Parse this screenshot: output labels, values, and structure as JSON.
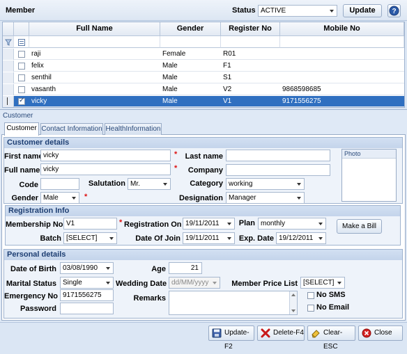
{
  "header": {
    "title": "Member",
    "status_label": "Status",
    "status_value": "ACTIVE",
    "update_label": "Update"
  },
  "grid": {
    "columns": [
      "Full Name",
      "Gender",
      "Register No",
      "Mobile No"
    ],
    "rows": [
      {
        "name": "raji",
        "gender": "Female",
        "reg": "R01",
        "mobile": "",
        "checked": false,
        "selected": false
      },
      {
        "name": "felix",
        "gender": "Male",
        "reg": "F1",
        "mobile": "",
        "checked": false,
        "selected": false
      },
      {
        "name": "senthil",
        "gender": "Male",
        "reg": "S1",
        "mobile": "",
        "checked": false,
        "selected": false
      },
      {
        "name": "vasanth",
        "gender": "Male",
        "reg": "V2",
        "mobile": "9868598685",
        "checked": false,
        "selected": false
      },
      {
        "name": "vicky",
        "gender": "Male",
        "reg": "V1",
        "mobile": "9171556275",
        "checked": true,
        "selected": true
      }
    ]
  },
  "panel": {
    "title": "Customer",
    "tabs": [
      "Customer",
      "Contact Information",
      "HealthInformation"
    ]
  },
  "customer_details": {
    "title": "Customer details",
    "first_name_label": "First name",
    "first_name": "vicky",
    "last_name_label": "Last name",
    "last_name": "",
    "full_name_label": "Full name",
    "full_name": "vicky",
    "company_label": "Company",
    "company": "",
    "code_label": "Code",
    "code": "",
    "salutation_label": "Salutation",
    "salutation": "Mr.",
    "category_label": "Category",
    "category": "working",
    "gender_label": "Gender",
    "gender": "Male",
    "designation_label": "Designation",
    "designation": "Manager",
    "photo_label": "Photo"
  },
  "registration": {
    "title": "Registration Info",
    "membership_label": "Membership No",
    "membership": "V1",
    "reg_on_label": "Registration On",
    "reg_on": "19/11/2011",
    "plan_label": "Plan",
    "plan": "monthly",
    "make_bill": "Make a Bill",
    "batch_label": "Batch",
    "batch": "[SELECT]",
    "doj_label": "Date Of Join",
    "doj": "19/11/2011",
    "exp_label": "Exp. Date",
    "exp": "19/12/2011"
  },
  "personal": {
    "title": "Personal details",
    "dob_label": "Date of Birth",
    "dob": "03/08/1990",
    "age_label": "Age",
    "age": "21",
    "marital_label": "Marital Status",
    "marital": "Single",
    "wedding_label": "Wedding Date",
    "wedding": "dd/MM/yyyy",
    "price_list_label": "Member Price List",
    "price_list": "[SELECT]",
    "emergency_label": "Emergency No",
    "emergency": "9171556275",
    "remarks_label": "Remarks",
    "remarks": "",
    "password_label": "Password",
    "password": "",
    "no_sms": "No SMS",
    "no_email": "No Email"
  },
  "footer": {
    "update": "Update-F2",
    "delete": "Delete-F4",
    "clear": "Clear-ESC",
    "close": "Close"
  }
}
